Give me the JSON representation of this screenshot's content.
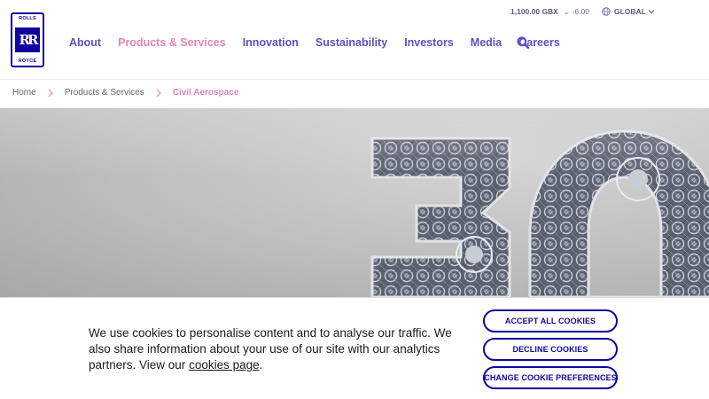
{
  "brand": {
    "logo_top": "ROLLS",
    "logo_bottom": "ROYCE",
    "logo_mono": "RR"
  },
  "nav": {
    "items": [
      {
        "label": "About",
        "active": false
      },
      {
        "label": "Products & Services",
        "active": true
      },
      {
        "label": "Innovation",
        "active": false
      },
      {
        "label": "Sustainability",
        "active": false
      },
      {
        "label": "Investors",
        "active": false
      },
      {
        "label": "Media",
        "active": false
      },
      {
        "label": "Careers",
        "active": false
      }
    ],
    "search_icon": "search-icon"
  },
  "utility": {
    "stock_price": "1,100.00 GBX",
    "stock_change": "-6.00",
    "stock_direction_icon": "arrow-down-icon",
    "region": "GLOBAL",
    "region_icon": "globe-icon"
  },
  "breadcrumb": {
    "items": [
      "Home",
      "Products & Services",
      "Civil Aerospace"
    ]
  },
  "hero": {
    "number": "30"
  },
  "cookie": {
    "text_before": "We use cookies to personalise content and to analyse our traffic. We also share information about your use of our site with our analytics partners. View our ",
    "link": "cookies page",
    "text_after": ".",
    "accept": "ACCEPT ALL COOKIES",
    "decline": "DECLINE COOKIES",
    "preferences": "CHANGE COOKIE PREFERENCES"
  },
  "colors": {
    "brand_blue": "#10069f",
    "nav_purple": "#5b50c8",
    "active_pink": "#e684b8"
  }
}
